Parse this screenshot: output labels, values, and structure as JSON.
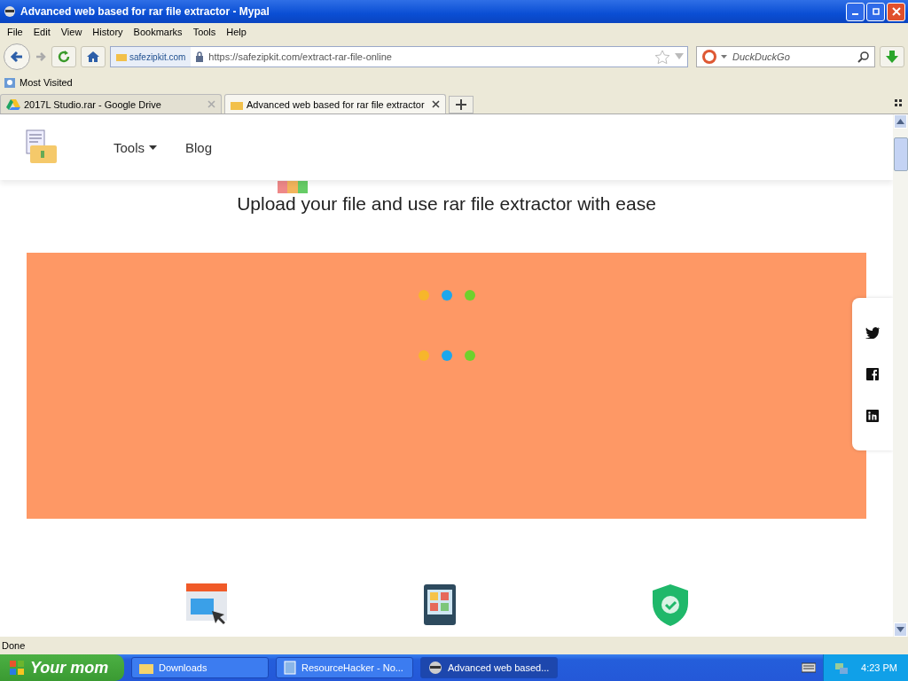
{
  "window": {
    "title": "Advanced web based for rar file extractor - Mypal"
  },
  "menu": [
    "File",
    "Edit",
    "View",
    "History",
    "Bookmarks",
    "Tools",
    "Help"
  ],
  "toolbar": {
    "identity": "safezipkit.com",
    "url": "https://safezipkit.com/extract-rar-file-online",
    "search_placeholder": "DuckDuckGo"
  },
  "bookmarks": [
    "Most Visited"
  ],
  "tabs": [
    {
      "label": "2017L Studio.rar - Google Drive",
      "kind": "drive",
      "selected": false
    },
    {
      "label": "Advanced web based for rar file extractor",
      "kind": "site",
      "selected": true
    }
  ],
  "page": {
    "nav": [
      {
        "label": "Tools",
        "has_menu": true
      },
      {
        "label": "Blog",
        "has_menu": false
      }
    ],
    "subtitle": "Upload your file and use rar file extractor with ease",
    "loader": {
      "dot_rows": [
        [
          {
            "color": "#f7b62b"
          },
          {
            "color": "#1ca7ec"
          },
          {
            "color": "#6fd12c"
          }
        ],
        [
          {
            "color": "#f7b62b"
          },
          {
            "color": "#1ca7ec"
          },
          {
            "color": "#6fd12c"
          }
        ]
      ]
    },
    "social": [
      {
        "kind": "twitter"
      },
      {
        "kind": "facebook"
      },
      {
        "kind": "linkedin"
      }
    ],
    "features": [
      {
        "kind": "browser"
      },
      {
        "kind": "tablet"
      },
      {
        "kind": "shield"
      }
    ]
  },
  "status_bar": "Done",
  "taskbar": {
    "start": "Your mom",
    "tasks": [
      {
        "label": "Downloads",
        "kind": "folder",
        "selected": false
      },
      {
        "label": "ResourceHacker - No...",
        "kind": "doc",
        "selected": false
      },
      {
        "label": "Advanced web based...",
        "kind": "browser",
        "selected": true
      }
    ],
    "clock": "4:23 PM"
  }
}
